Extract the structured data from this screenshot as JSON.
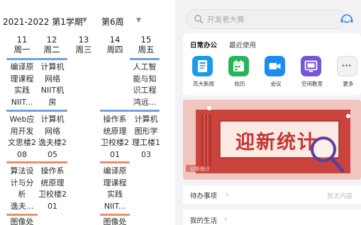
{
  "timetable": {
    "term": "2021-2022 第1学期",
    "week": "第6周",
    "days": [
      {
        "num": "11",
        "weekday": "周一"
      },
      {
        "num": "12",
        "weekday": "周二"
      },
      {
        "num": "13",
        "weekday": "周三"
      },
      {
        "num": "14",
        "weekday": "周四"
      },
      {
        "num": "15",
        "weekday": "周五"
      }
    ],
    "cells": [
      {
        "text": "编译原\n理课程\n实践\nNIIT..."
      },
      {
        "text": "计算机\n网络\nNIIT机\n房"
      },
      {
        "text": "人工智\n能与知\n识工程\n鸿远..."
      },
      {
        "text": "Web应\n用开发\n文思楼2\n08"
      },
      {
        "text": "计算机\n网络\n逸夫楼2\n05"
      },
      {
        "text": "操作系\n统原理\n卫校楼2\n01"
      },
      {
        "text": "计算机\n图形学\n理工楼1\n03"
      },
      {
        "text": "算法设\n计与分\n析\n逸夫..."
      },
      {
        "text": "操作系\n统原理\n卫校楼2\n01"
      },
      {
        "text": "编译原\n理课程\n实践\nNIIT..."
      },
      {
        "text": "图像处"
      },
      {
        "text": "图像处"
      }
    ],
    "colors": {
      "blue": "#6fa3d8",
      "orange": "#ef8e66"
    }
  },
  "app": {
    "search_placeholder": "开发者大赛",
    "tabs": {
      "common": "日常办公",
      "recent": "最近使用"
    },
    "apps": [
      {
        "label": "苏大新闻",
        "icon": "newspaper-icon",
        "color": "#1e9be8"
      },
      {
        "label": "校历",
        "icon": "calendar-icon",
        "color": "#2bb35c"
      },
      {
        "label": "会议",
        "icon": "video-camera-icon",
        "color": "#1c8bf2"
      },
      {
        "label": "空闲教室",
        "icon": "classroom-icon",
        "color": "#7656d8"
      },
      {
        "label": "更多",
        "icon": "more-icon",
        "color": "#eeeeee"
      }
    ],
    "banner": {
      "text": "迎新统计",
      "watermark": "迎新统计"
    },
    "todo": {
      "title": "待办事项",
      "empty": "暂无内容"
    },
    "life": {
      "title": "我的生活"
    }
  }
}
